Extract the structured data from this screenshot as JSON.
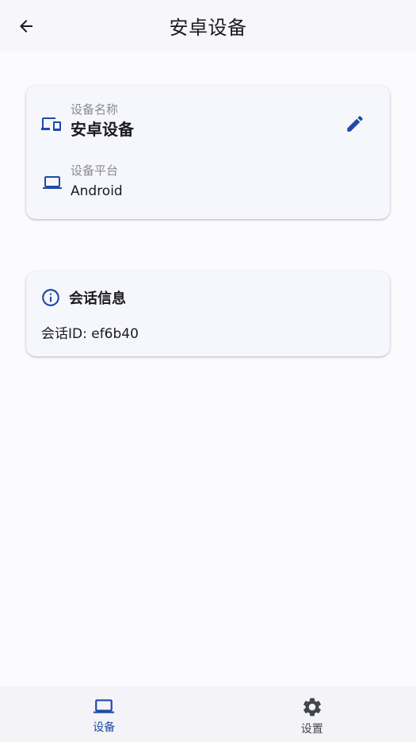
{
  "appbar": {
    "title": "安卓设备"
  },
  "device_card": {
    "name_label": "设备名称",
    "name_value": "安卓设备",
    "platform_label": "设备平台",
    "platform_value": "Android"
  },
  "session_card": {
    "title": "会话信息",
    "session_id_text": "会话ID: ef6b40"
  },
  "bottom_nav": {
    "items": [
      {
        "label": "设备",
        "icon": "laptop-icon",
        "active": true
      },
      {
        "label": "设置",
        "icon": "gear-icon",
        "active": false
      }
    ]
  },
  "colors": {
    "accent": "#1f4aa8",
    "background": "#fbfbfe",
    "card": "#f6f7fd",
    "text": "#1b1b1f",
    "muted": "#8a8a90"
  }
}
